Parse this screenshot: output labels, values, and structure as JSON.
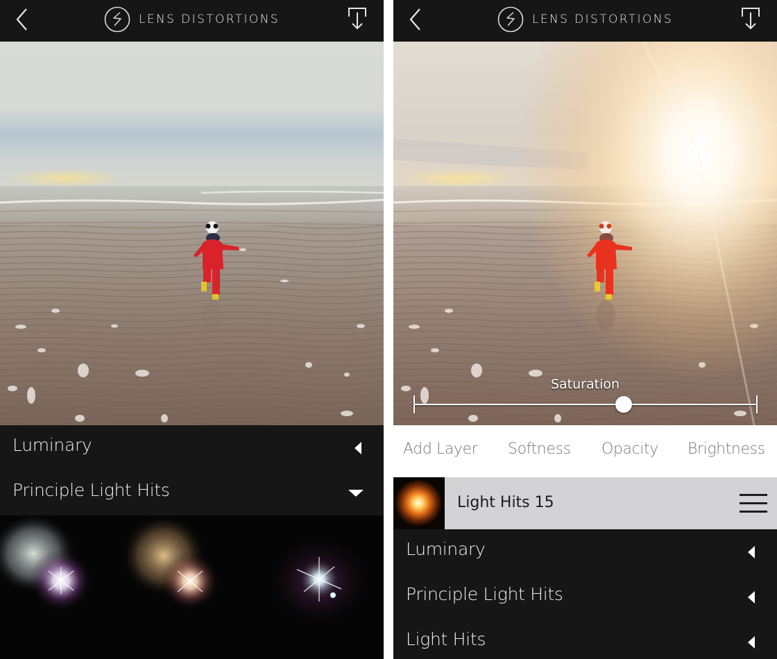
{
  "app": {
    "title": "LENS DISTORTIONS",
    "icons": {
      "back": "chevron-left-icon",
      "logo": "lens-distortions-logo-icon",
      "export": "download-export-icon"
    }
  },
  "left_screen": {
    "categories": [
      {
        "label": "Luminary",
        "state": "collapsed",
        "indicator": "triangle-left-icon"
      },
      {
        "label": "Principle Light Hits",
        "state": "expanded",
        "indicator": "triangle-down-icon"
      }
    ],
    "flare_thumbnails": [
      {
        "name": "flare-preview-cool-white"
      },
      {
        "name": "flare-preview-warm-gold"
      },
      {
        "name": "flare-preview-magenta-star"
      }
    ]
  },
  "right_screen": {
    "slider": {
      "label": "Saturation",
      "value_fraction": 0.61
    },
    "tools": [
      "Add Layer",
      "Softness",
      "Opacity",
      "Brightness"
    ],
    "layer": {
      "name": "Light Hits 15",
      "menu_icon": "hamburger-menu-icon"
    },
    "categories": [
      {
        "label": "Luminary",
        "state": "collapsed"
      },
      {
        "label": "Principle Light Hits",
        "state": "collapsed"
      },
      {
        "label": "Light Hits",
        "state": "collapsed"
      }
    ]
  },
  "colors": {
    "bar_bg": "#161616",
    "tools_bg": "#ffffff",
    "tools_text": "#777777",
    "layer_bg": "#d3d2d4",
    "text_light": "#f0f0f0"
  }
}
